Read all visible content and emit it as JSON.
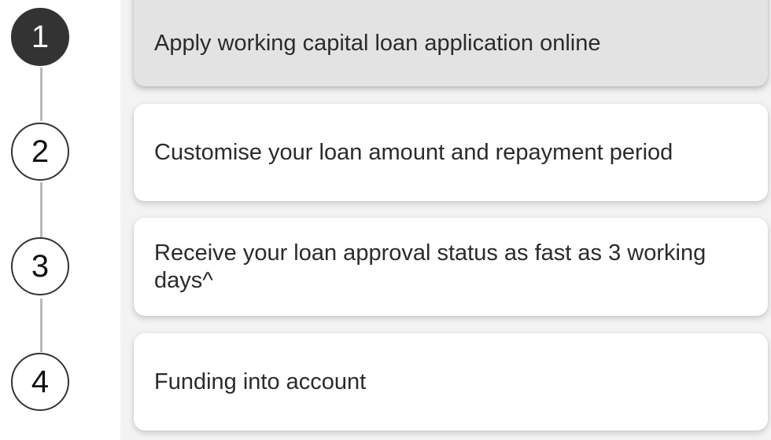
{
  "steps": [
    {
      "number": "1",
      "label": "Apply working capital loan application online",
      "active": true
    },
    {
      "number": "2",
      "label": "Customise your loan amount and repayment period",
      "active": false
    },
    {
      "number": "3",
      "label": "Receive your loan approval status as fast as 3 working days^",
      "active": false
    },
    {
      "number": "4",
      "label": "Funding into account",
      "active": false
    }
  ],
  "colors": {
    "active_circle": "#333333",
    "active_card": "#e3e3e3",
    "connector": "#b9b9b9",
    "panel_background": "#f3f3f3"
  }
}
